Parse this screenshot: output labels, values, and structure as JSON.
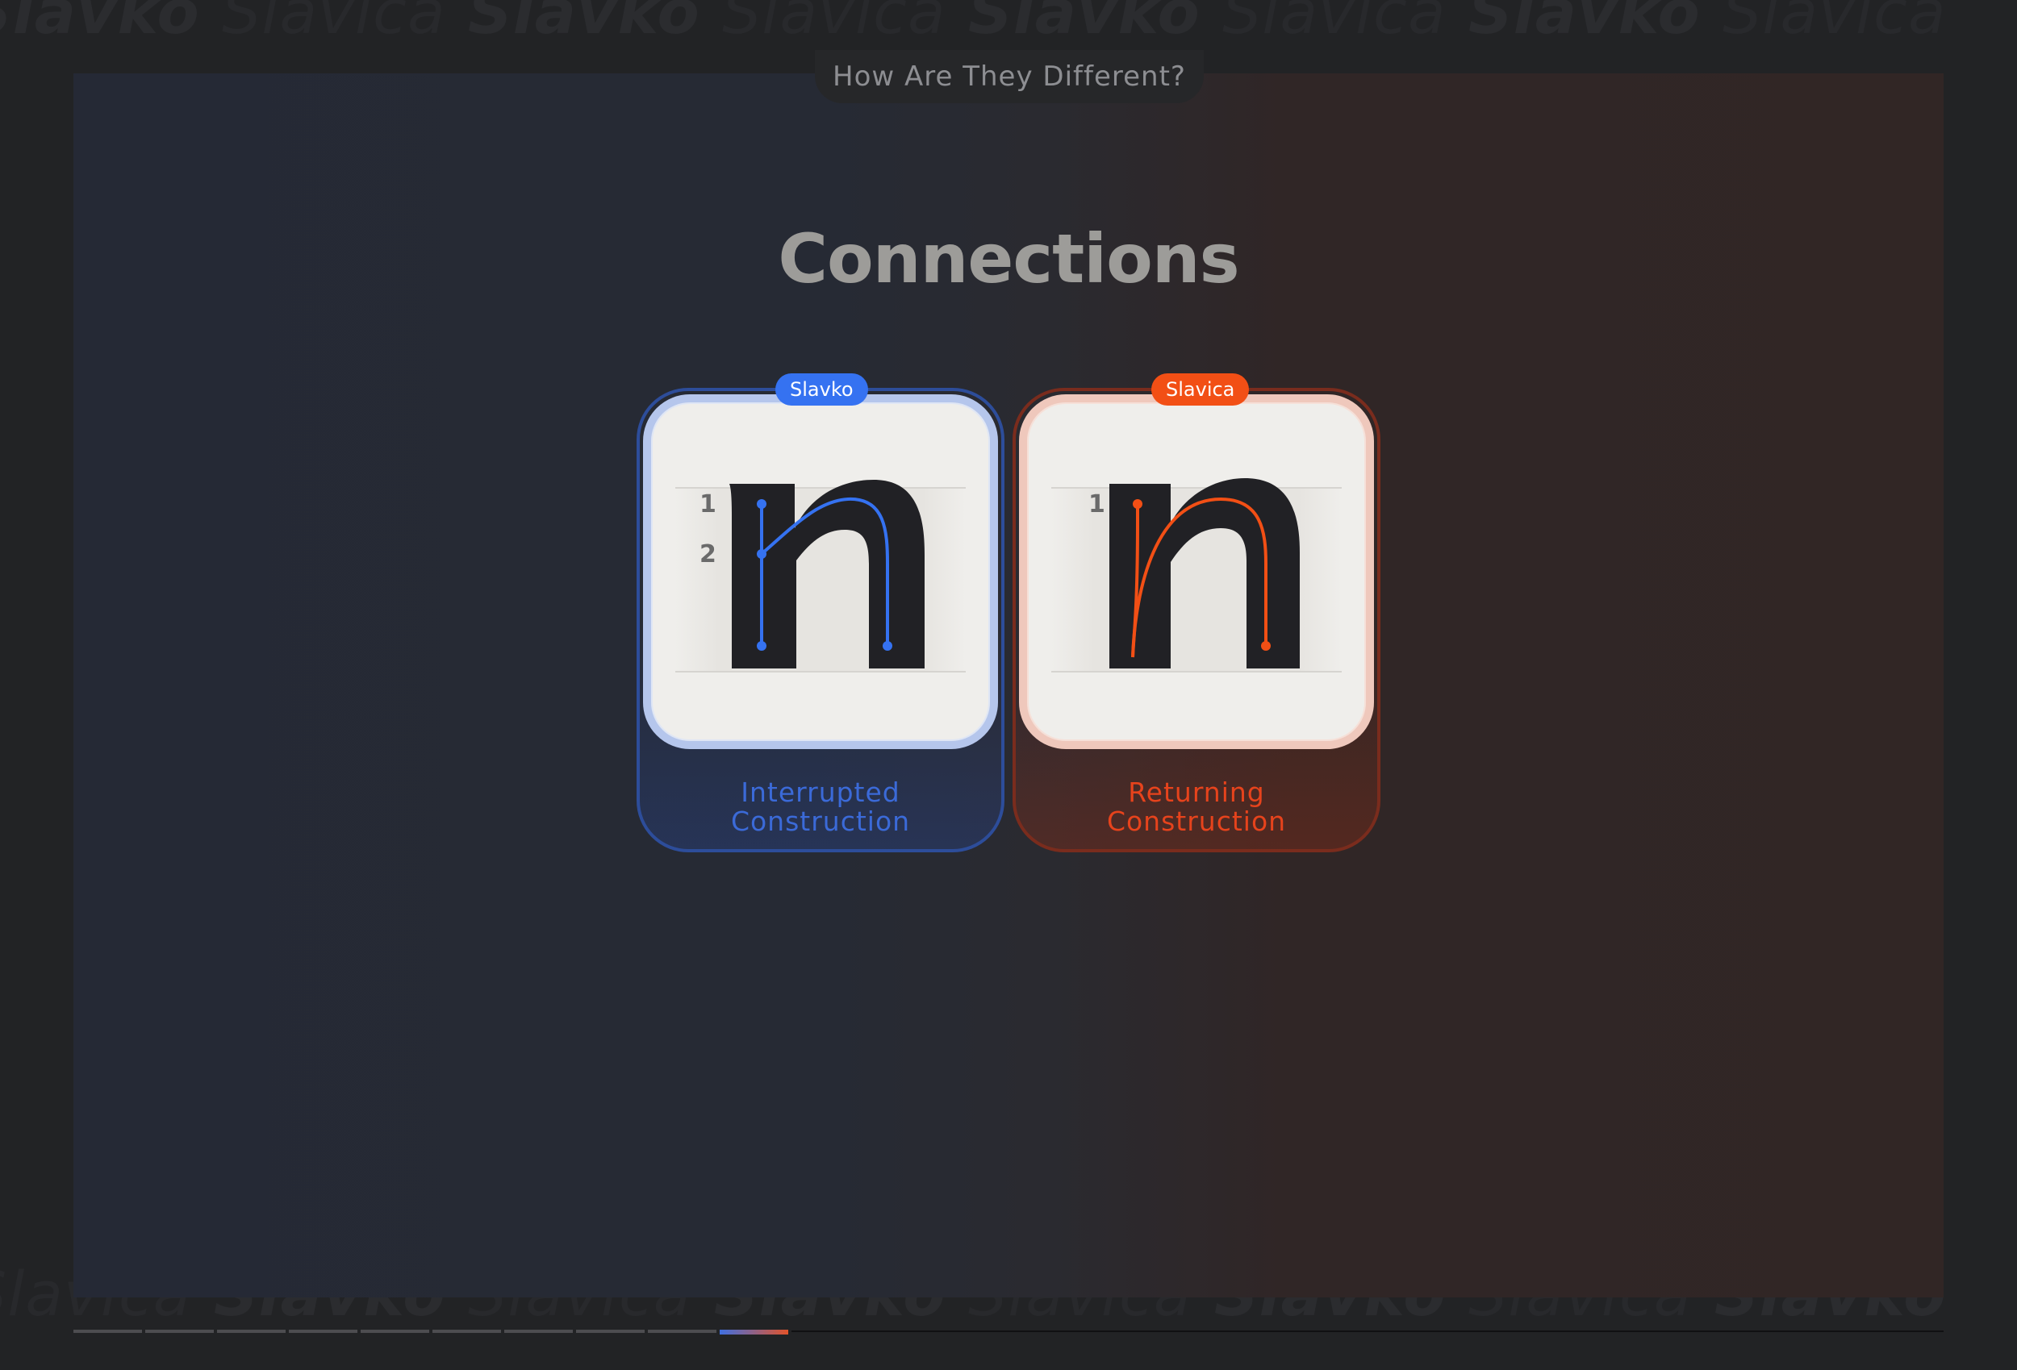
{
  "page": {
    "section_tab": "How Are They Different?",
    "heading": "Connections"
  },
  "background_words": [
    "Slavko",
    "Slavica"
  ],
  "cards": [
    {
      "badge": "Slavko",
      "glyph": "n",
      "label_line1": "Interrupted",
      "label_line2": "Construction",
      "accent": "#3572f1",
      "markers": [
        "1",
        "2"
      ]
    },
    {
      "badge": "Slavica",
      "glyph": "n",
      "label_line1": "Returning",
      "label_line2": "Construction",
      "accent": "#f24f15",
      "markers": [
        "1"
      ]
    }
  ],
  "progress": {
    "total_segments": 10,
    "current_segment": 10
  },
  "colors": {
    "slavko_blue": "#3572f1",
    "slavica_orange": "#f24f15",
    "heading": "#9d9c99"
  }
}
